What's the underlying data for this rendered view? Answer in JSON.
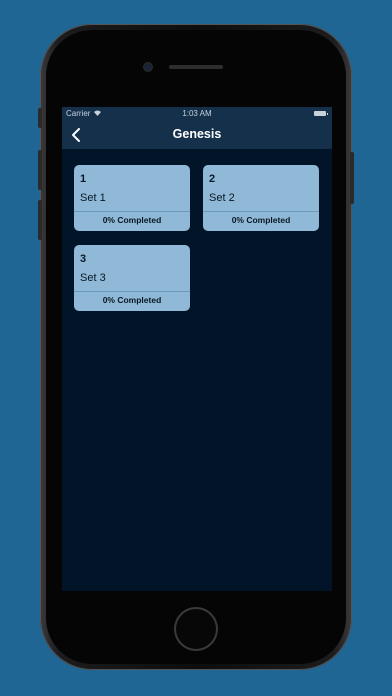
{
  "status_bar": {
    "carrier": "Carrier",
    "time": "1:03 AM"
  },
  "nav": {
    "title": "Genesis",
    "back_icon": "chevron-left-icon"
  },
  "sets": [
    {
      "number": "1",
      "name": "Set 1",
      "progress": "0% Completed"
    },
    {
      "number": "2",
      "name": "Set 2",
      "progress": "0% Completed"
    },
    {
      "number": "3",
      "name": "Set 3",
      "progress": "0% Completed"
    }
  ],
  "colors": {
    "background": "#1f6694",
    "screen": "#021427",
    "nav_bar": "#15304b",
    "card": "#8fb9d6"
  }
}
